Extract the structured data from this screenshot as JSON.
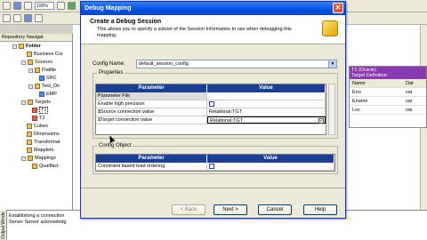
{
  "toolbar": {
    "zoom": "100%"
  },
  "navigator": {
    "title": "Repository Navigat",
    "items": [
      {
        "label": "Folder",
        "bold": true
      },
      {
        "label": "Business Cor"
      },
      {
        "label": "Sources"
      },
      {
        "label": "Flatfile"
      },
      {
        "label": "SRC"
      },
      {
        "label": "Test_Dir"
      },
      {
        "label": "EMP"
      },
      {
        "label": "Targets"
      },
      {
        "label": "T1"
      },
      {
        "label": "T2"
      },
      {
        "label": "Cubes"
      },
      {
        "label": "Dimensions"
      },
      {
        "label": "Transformat"
      },
      {
        "label": "Mapplets"
      },
      {
        "label": "Mappings"
      },
      {
        "label": "Quallfact"
      }
    ]
  },
  "output": {
    "side_tab": "Output Windo",
    "lines": [
      "Establishing a connection",
      "Server Server acknowledg"
    ]
  },
  "target_panel": {
    "title": "T1 (Oracle)",
    "subtitle": "Target Definition",
    "col1": "Name",
    "col2": "Dat",
    "rows": [
      {
        "name": "Eno",
        "type": "var"
      },
      {
        "name": "Ename",
        "type": "var"
      },
      {
        "name": "Loc",
        "type": "var"
      }
    ]
  },
  "dialog": {
    "title": "Debug Mapping",
    "close": "✕",
    "banner_title": "Create a Debug Session",
    "banner_desc": "This allows you to specify a subset of the Session Information to use when debugging this mapping.",
    "config_label": "Config Name:",
    "config_value": "default_session_config",
    "properties_label": "Properties",
    "properties_header": {
      "param": "Parameter",
      "value": "Value"
    },
    "properties_rows": [
      {
        "param": "Parameter File",
        "value": "",
        "checkbox": false,
        "browse": false
      },
      {
        "param": "Enable high precision",
        "value": "",
        "checkbox": true,
        "browse": false
      },
      {
        "param": "$Source connection value",
        "value": "Relational:TGT",
        "checkbox": false,
        "browse": false
      },
      {
        "param": "$Target connection value",
        "value": "Relational:TGT",
        "checkbox": false,
        "browse": true
      }
    ],
    "config_object_label": "Config Object",
    "config_object_header": {
      "param": "Parameter",
      "value": "Value"
    },
    "config_object_rows": [
      {
        "param": "Constraint based load ordering",
        "checkbox": true
      }
    ],
    "buttons": {
      "back": "< Back",
      "next": "Next >",
      "cancel": "Cancel",
      "help": "Help"
    }
  }
}
